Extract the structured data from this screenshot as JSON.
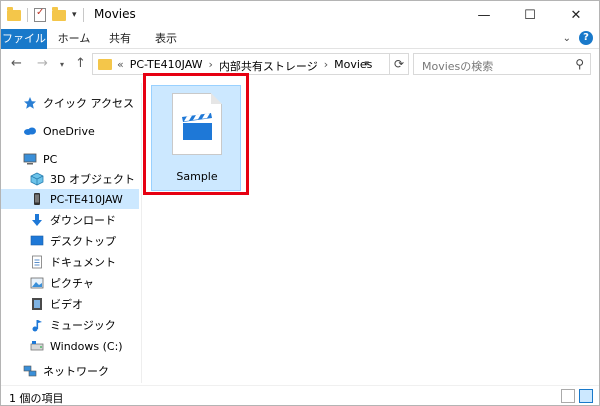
{
  "window": {
    "title": "Movies"
  },
  "ribbon": {
    "tabs": [
      {
        "label": "ファイル"
      },
      {
        "label": "ホーム"
      },
      {
        "label": "共有"
      },
      {
        "label": "表示"
      }
    ],
    "help": "?",
    "collapse": "⌄"
  },
  "titlebar_buttons": {
    "minimize": "—",
    "maximize": "☐",
    "close": "✕"
  },
  "address": {
    "overflow": "«",
    "crumbs": [
      "PC-TE410JAW",
      "内部共有ストレージ",
      "Movies"
    ],
    "separator": "›"
  },
  "search": {
    "placeholder": "Moviesの検索"
  },
  "sidebar": {
    "items": [
      {
        "label": "クイック アクセス",
        "icon": "star-icon"
      },
      {
        "label": "OneDrive",
        "icon": "cloud-icon"
      },
      {
        "label": "PC",
        "icon": "computer-icon"
      },
      {
        "label": "3D オブジェクト",
        "icon": "cube-icon"
      },
      {
        "label": "PC-TE410JAW",
        "icon": "device-icon",
        "selected": true
      },
      {
        "label": "ダウンロード",
        "icon": "download-icon"
      },
      {
        "label": "デスクトップ",
        "icon": "desktop-icon"
      },
      {
        "label": "ドキュメント",
        "icon": "document-icon"
      },
      {
        "label": "ピクチャ",
        "icon": "picture-icon"
      },
      {
        "label": "ビデオ",
        "icon": "video-icon"
      },
      {
        "label": "ミュージック",
        "icon": "music-icon"
      },
      {
        "label": "Windows (C:)",
        "icon": "drive-icon"
      },
      {
        "label": "ネットワーク",
        "icon": "network-icon"
      }
    ]
  },
  "files": [
    {
      "name": "Sample",
      "icon": "video-file-icon",
      "selected": true
    }
  ],
  "status": {
    "text": "1 個の項目"
  },
  "colors": {
    "accent": "#1979ca",
    "selection": "#cce8ff",
    "highlight_border": "#e60012",
    "clapper_blue": "#1e78d7"
  }
}
